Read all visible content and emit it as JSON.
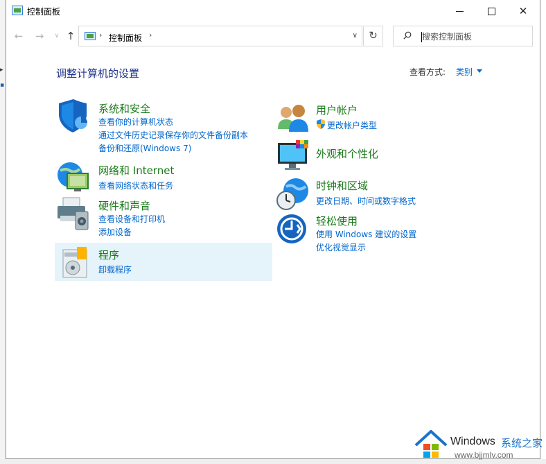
{
  "window": {
    "title": "控制面板"
  },
  "nav": {
    "back": "←",
    "forward": "→",
    "recent": "∨",
    "up": "↑",
    "crumb": "控制面板",
    "search_placeholder": "搜索控制面板",
    "refresh": "↻"
  },
  "main": {
    "heading": "调整计算机的设置",
    "view_by_label": "查看方式:",
    "view_by_value": "类别"
  },
  "categories": [
    {
      "title": "系统和安全",
      "links": [
        "查看你的计算机状态",
        "通过文件历史记录保存你的文件备份副本",
        "备份和还原(Windows 7)"
      ]
    },
    {
      "title": "网络和 Internet",
      "links": [
        "查看网络状态和任务"
      ]
    },
    {
      "title": "硬件和声音",
      "links": [
        "查看设备和打印机",
        "添加设备"
      ]
    },
    {
      "title": "程序",
      "links": [
        "卸载程序"
      ]
    },
    {
      "title": "用户帐户",
      "links": [
        "更改帐户类型"
      ]
    },
    {
      "title": "外观和个性化",
      "links": []
    },
    {
      "title": "时钟和区域",
      "links": [
        "更改日期、时间或数字格式"
      ]
    },
    {
      "title": "轻松使用",
      "links": [
        "使用 Windows 建议的设置",
        "优化视觉显示"
      ]
    }
  ],
  "watermark": {
    "brand": "Windows",
    "site_cn": "系统之家",
    "url": "www.bjjmlv.com"
  },
  "colors": {
    "link": "#0066cc",
    "category_title": "#1a7a1a",
    "heading": "#1e3287",
    "highlight": "#e5f3fb"
  }
}
